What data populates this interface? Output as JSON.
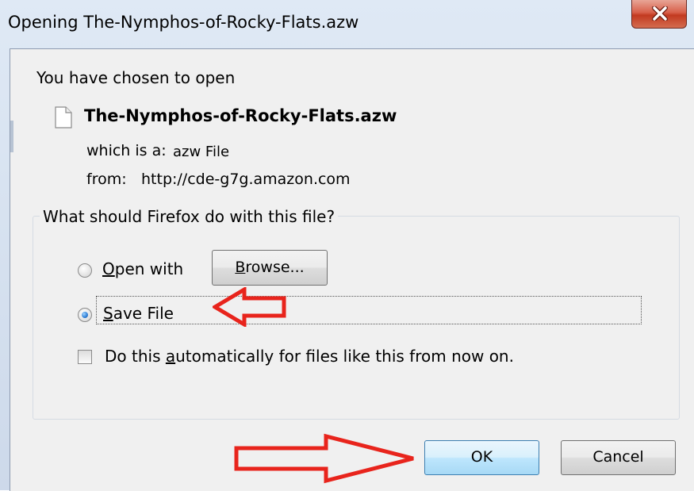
{
  "window": {
    "title": "Opening The-Nymphos-of-Rocky-Flats.azw"
  },
  "dialog": {
    "intro": "You have chosen to open",
    "filename": "The-Nymphos-of-Rocky-Flats.azw",
    "which_is_label": "which is a:",
    "which_is_value": "azw File",
    "from_label": "from:",
    "from_value": "http://cde-g7g.amazon.com"
  },
  "action_group": {
    "legend": "What should Firefox do with this file?",
    "open_with_label": "Open with",
    "browse_label": "Browse...",
    "save_file_label": "Save File",
    "selected_option": "Save File",
    "auto_checkbox_label": "Do this automatically for files like this from now on.",
    "auto_checkbox_checked": false
  },
  "buttons": {
    "ok_label": "OK",
    "cancel_label": "Cancel"
  },
  "annotations": {
    "arrow_color": "#e8241c"
  },
  "icons": {
    "close": "close-icon",
    "file": "file-icon",
    "arrow_save": "red-arrow-left-icon",
    "arrow_ok": "red-arrow-right-icon"
  }
}
